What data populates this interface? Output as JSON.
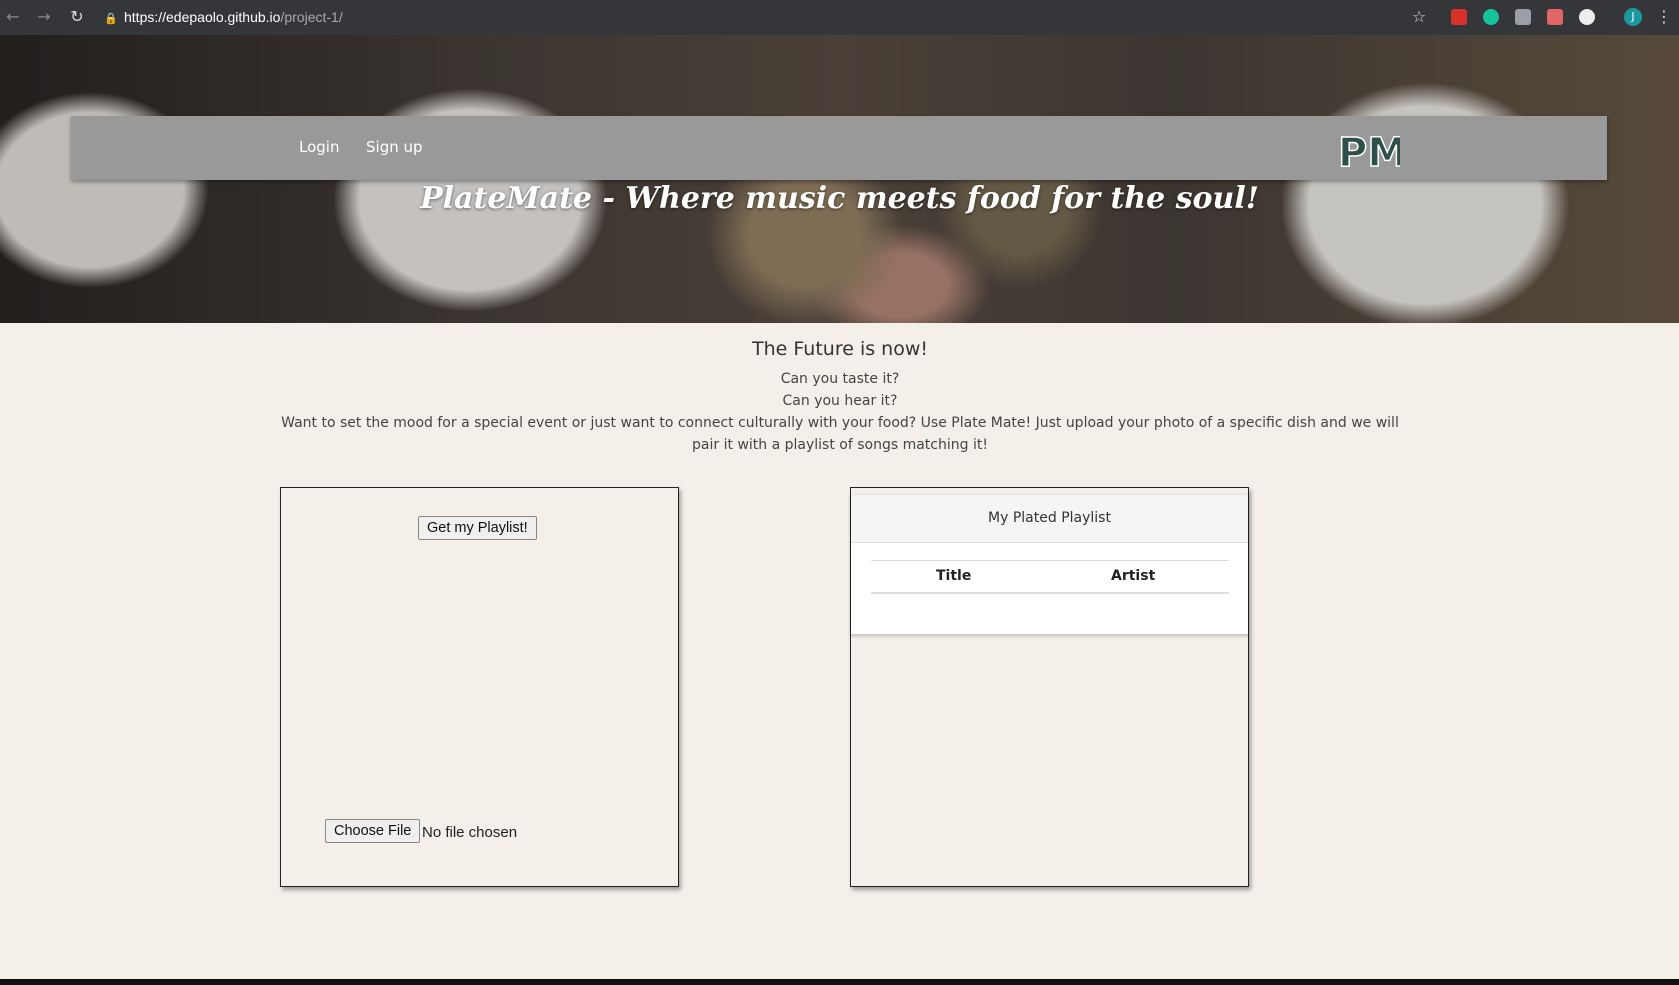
{
  "browser": {
    "url_host": "https://edepaolo.github.io",
    "url_path": "/project-1/",
    "profile_initial": "J"
  },
  "nav": {
    "login": "Login",
    "signup": "Sign up",
    "logo_text": "PM"
  },
  "hero": {
    "tagline": "PlateMate - Where music meets food for the soul!"
  },
  "intro": {
    "heading": "The Future is now!",
    "line1": "Can you taste it?",
    "line2": "Can you hear it?",
    "line3": "Want to set the mood for a special event or just want to connect culturally with your food? Use Plate Mate! Just upload your photo of a specific dish and we will pair it with a playlist of songs matching it!"
  },
  "upload_panel": {
    "get_playlist_label": "Get my Playlist!",
    "choose_file_label": "Choose File",
    "no_file_text": "No file chosen"
  },
  "playlist_panel": {
    "title": "My Plated Playlist",
    "columns": [
      "Title",
      "Artist"
    ]
  }
}
